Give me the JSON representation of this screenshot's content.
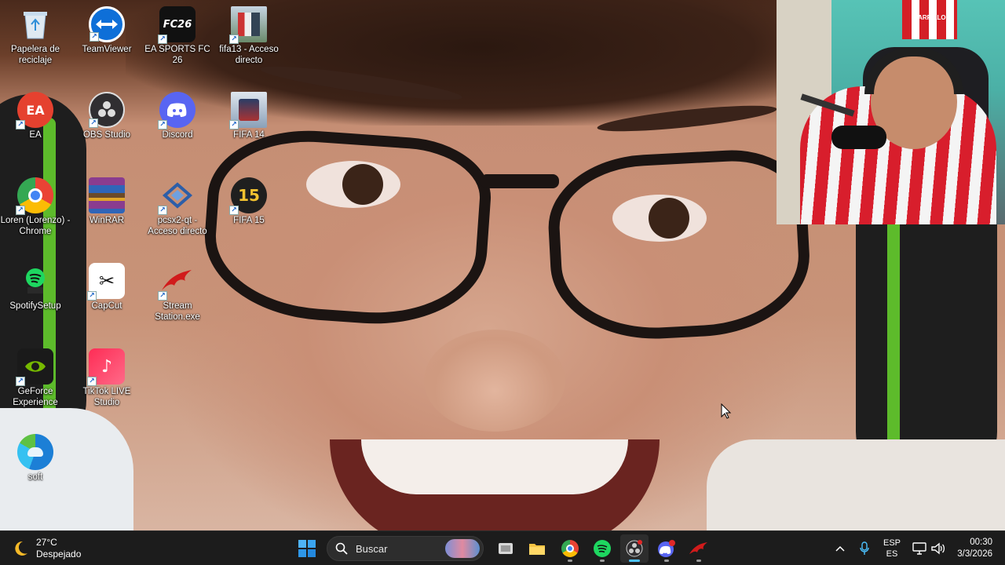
{
  "desktop": {
    "icons": [
      {
        "id": "recycle-bin",
        "label": "Papelera de\nreciclaje",
        "icon": "recycle-bin-icon",
        "color": "#6fb3e0"
      },
      {
        "id": "ea",
        "label": "EA",
        "icon": "ea-icon",
        "color": "#e03a2c"
      },
      {
        "id": "chrome",
        "label": "Loren (Lorenzo) -\nChrome",
        "icon": "chrome-icon",
        "color": "#4285f4"
      },
      {
        "id": "spotify-setup",
        "label": "SpotifySetup",
        "icon": "spotify-icon",
        "color": "#1ed760"
      },
      {
        "id": "geforce",
        "label": "GeForce\nExperience",
        "icon": "nvidia-icon",
        "color": "#76b900"
      },
      {
        "id": "edge",
        "label": "soft",
        "icon": "edge-icon",
        "color": "#1a9bd7"
      },
      {
        "id": "teamviewer",
        "label": "TeamViewer",
        "icon": "teamviewer-icon",
        "color": "#0e6fd8"
      },
      {
        "id": "obs",
        "label": "OBS Studio",
        "icon": "obs-icon",
        "color": "#302e31"
      },
      {
        "id": "winrar",
        "label": "WinRAR",
        "icon": "winrar-icon",
        "color": "#8a3c8f"
      },
      {
        "id": "capcut",
        "label": "CapCut",
        "icon": "capcut-icon",
        "color": "#ffffff"
      },
      {
        "id": "tiktok-live",
        "label": "TikTok LIVE\nStudio",
        "icon": "tiktok-icon",
        "color": "#fe2c55"
      },
      {
        "id": "fc26",
        "label": "EA SPORTS FC 26",
        "icon": "fc26-icon",
        "color": "#111111",
        "tile_text": "FC26"
      },
      {
        "id": "discord",
        "label": "Discord",
        "icon": "discord-icon",
        "color": "#5865f2"
      },
      {
        "id": "pcsx2",
        "label": "pcsx2-qt -\nAcceso directo",
        "icon": "pcsx2-icon",
        "color": "#2c5ea8"
      },
      {
        "id": "stream-station",
        "label": "Stream\nStation.exe",
        "icon": "redragon-icon",
        "color": "#d11b1b"
      },
      {
        "id": "fifa13",
        "label": "fifa13 - Acceso\ndirecto",
        "icon": "fifa13-icon",
        "color": "#b8c7d8"
      },
      {
        "id": "fifa14",
        "label": "FIFA 14",
        "icon": "fifa14-icon",
        "color": "#c9d2dd"
      },
      {
        "id": "fifa15",
        "label": "FIFA 15",
        "icon": "fifa15-icon",
        "color": "#222222",
        "tile_text": "15"
      }
    ]
  },
  "webcam": {
    "jersey_text": "CARRILLO"
  },
  "taskbar": {
    "weather": {
      "temp": "27°C",
      "condition": "Despejado"
    },
    "search": {
      "label": "Buscar"
    },
    "apps": [
      {
        "id": "start",
        "icon": "windows-start-icon"
      },
      {
        "id": "task-view",
        "icon": "task-view-icon"
      },
      {
        "id": "file-explorer",
        "icon": "folder-icon"
      },
      {
        "id": "chrome",
        "icon": "chrome-icon"
      },
      {
        "id": "spotify",
        "icon": "spotify-icon"
      },
      {
        "id": "obs",
        "icon": "obs-icon"
      },
      {
        "id": "discord",
        "icon": "discord-icon"
      },
      {
        "id": "redragon",
        "icon": "redragon-icon"
      }
    ],
    "tray": {
      "language_top": "ESP",
      "language_bottom": "ES",
      "time": "00:30",
      "date": "3/3/2026"
    }
  }
}
